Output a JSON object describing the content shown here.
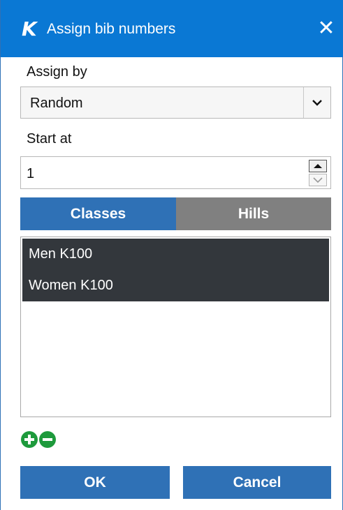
{
  "window": {
    "title": "Assign bib numbers",
    "app_icon": "K",
    "close_glyph": "✕"
  },
  "assign_by": {
    "label": "Assign by",
    "value": "Random"
  },
  "start_at": {
    "label": "Start at",
    "value": "1"
  },
  "tabs": [
    {
      "label": "Classes",
      "active": true
    },
    {
      "label": "Hills",
      "active": false
    }
  ],
  "list": {
    "items": [
      {
        "label": "Men K100",
        "selected": true
      },
      {
        "label": "Women K100",
        "selected": true
      }
    ]
  },
  "footer": {
    "ok_label": "OK",
    "cancel_label": "Cancel"
  },
  "colors": {
    "titlebar": "#0a78d4",
    "accent": "#2f71b6",
    "inactive_tab": "#808080",
    "selected_row": "#33373c",
    "icon_green": "#1e9a3c"
  }
}
